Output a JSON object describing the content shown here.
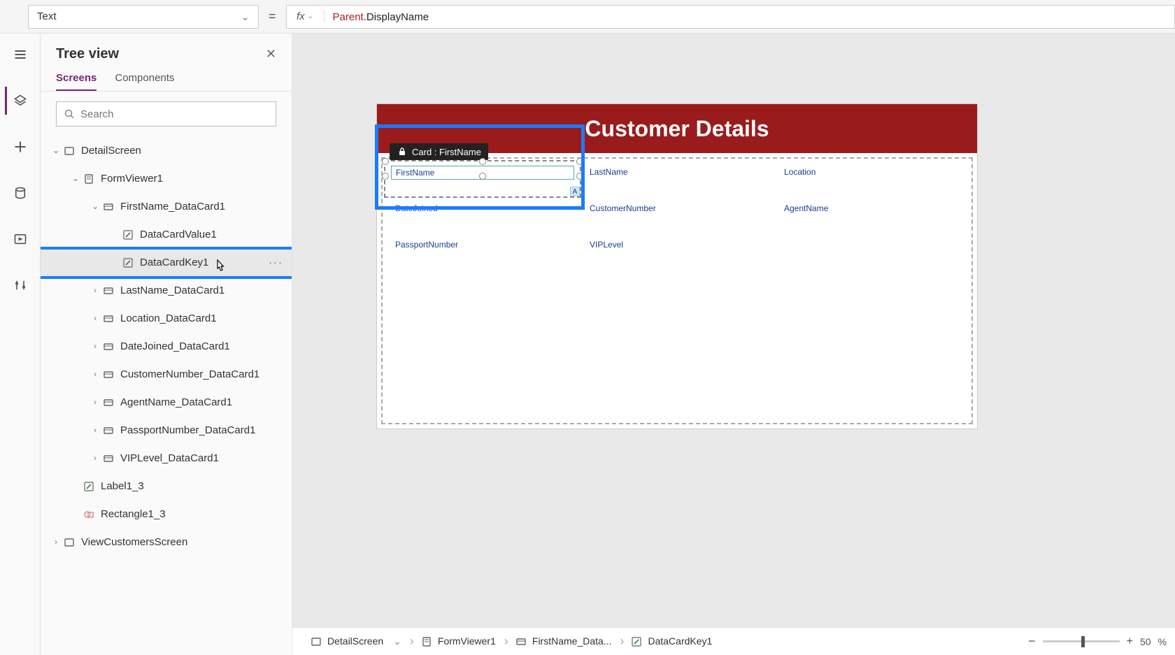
{
  "property_selector": {
    "value": "Text"
  },
  "formula": {
    "fx": "fx",
    "object": "Parent",
    "prop": ".DisplayName"
  },
  "tree": {
    "title": "Tree view",
    "tabs": [
      "Screens",
      "Components"
    ],
    "active_tab": "Screens",
    "search_placeholder": "Search",
    "items": [
      {
        "label": "DetailScreen",
        "indent": 0,
        "chev": "v",
        "icon": "screen"
      },
      {
        "label": "FormViewer1",
        "indent": 1,
        "chev": "v",
        "icon": "doc"
      },
      {
        "label": "FirstName_DataCard1",
        "indent": 2,
        "chev": "v",
        "icon": "card"
      },
      {
        "label": "DataCardValue1",
        "indent": 3,
        "chev": "",
        "icon": "edit"
      },
      {
        "label": "DataCardKey1",
        "indent": 3,
        "chev": "",
        "icon": "edit",
        "selected": true,
        "more": true
      },
      {
        "label": "LastName_DataCard1",
        "indent": 2,
        "chev": ">",
        "icon": "card"
      },
      {
        "label": "Location_DataCard1",
        "indent": 2,
        "chev": ">",
        "icon": "card"
      },
      {
        "label": "DateJoined_DataCard1",
        "indent": 2,
        "chev": ">",
        "icon": "card"
      },
      {
        "label": "CustomerNumber_DataCard1",
        "indent": 2,
        "chev": ">",
        "icon": "card"
      },
      {
        "label": "AgentName_DataCard1",
        "indent": 2,
        "chev": ">",
        "icon": "card"
      },
      {
        "label": "PassportNumber_DataCard1",
        "indent": 2,
        "chev": ">",
        "icon": "card"
      },
      {
        "label": "VIPLevel_DataCard1",
        "indent": 2,
        "chev": ">",
        "icon": "card"
      },
      {
        "label": "Label1_3",
        "indent": 1,
        "chev": "",
        "icon": "edit"
      },
      {
        "label": "Rectangle1_3",
        "indent": 1,
        "chev": "",
        "icon": "shape"
      },
      {
        "label": "ViewCustomersScreen",
        "indent": 0,
        "chev": ">",
        "icon": "screen"
      }
    ]
  },
  "canvas": {
    "screen_title": "Customer Details",
    "selected_tooltip": "Card : FirstName",
    "selected_field_label": "FirstName",
    "a_badge": "A",
    "fields": [
      "FirstName",
      "LastName",
      "Location",
      "DateJoined",
      "CustomerNumber",
      "AgentName",
      "PassportNumber",
      "VIPLevel"
    ]
  },
  "breadcrumb": [
    {
      "label": "DetailScreen",
      "icon": "screen",
      "chev": true
    },
    {
      "label": "FormViewer1",
      "icon": "doc"
    },
    {
      "label": "FirstName_Data...",
      "icon": "card"
    },
    {
      "label": "DataCardKey1",
      "icon": "edit"
    }
  ],
  "zoom": {
    "minus": "−",
    "plus": "+",
    "value": "50",
    "pct": "%"
  }
}
